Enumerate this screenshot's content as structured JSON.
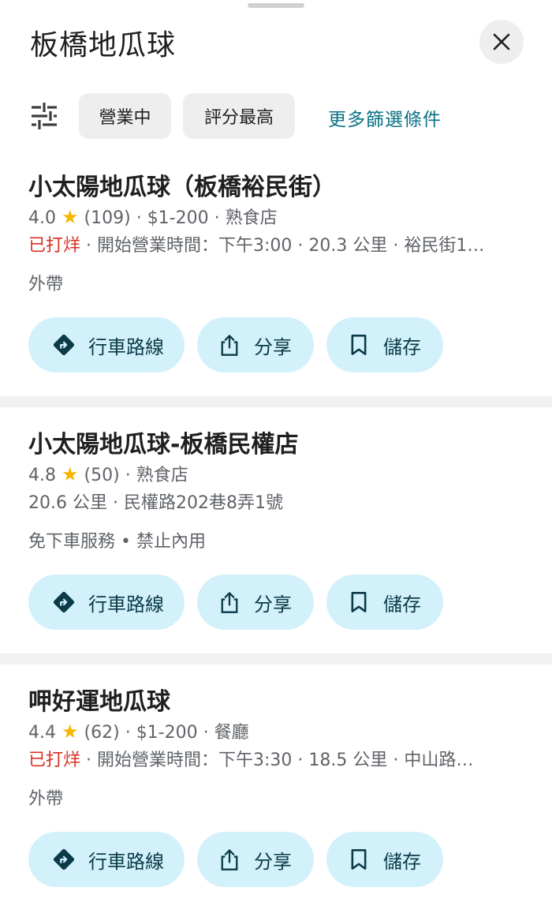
{
  "search": {
    "title": "板橋地瓜球"
  },
  "filters": {
    "open_now": "營業中",
    "top_rated": "評分最高",
    "more": "更多篩選條件"
  },
  "actions": {
    "route": "行車路線",
    "share": "分享",
    "save": "儲存"
  },
  "results": [
    {
      "name": "小太陽地瓜球（板橋裕民街）",
      "rating": "4.0",
      "reviews": "(109)",
      "price": "$1-200",
      "category": "熟食店",
      "status": "已打烊",
      "hours": "開始營業時間：下午3:00",
      "distance": "20.3 公里",
      "address": "裕民街1…",
      "services": "外帶"
    },
    {
      "name": "小太陽地瓜球-板橋民權店",
      "rating": "4.8",
      "reviews": "(50)",
      "category": "熟食店",
      "distance": "20.6 公里",
      "address": "民權路202巷8弄1號",
      "services": "免下車服務 • 禁止內用"
    },
    {
      "name": "呷好運地瓜球",
      "rating": "4.4",
      "reviews": "(62)",
      "price": "$1-200",
      "category": "餐廳",
      "status": "已打烊",
      "hours": "開始營業時間：下午3:30",
      "distance": "18.5 公里",
      "address": "中山路…",
      "services": "外帶"
    }
  ]
}
